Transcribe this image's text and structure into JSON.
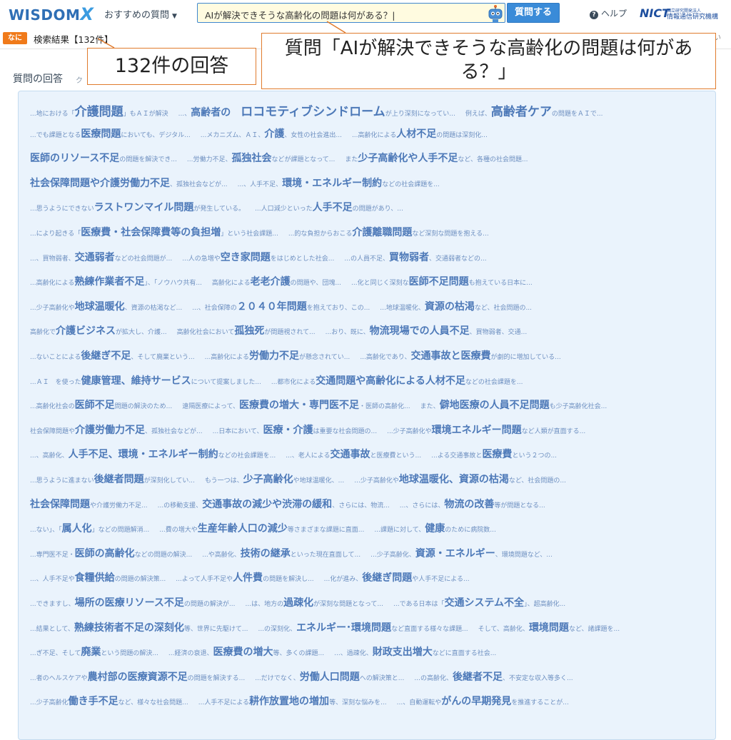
{
  "header": {
    "logo_main": "WISDOM",
    "logo_x": "X",
    "recommended_label": "おすすめの質問",
    "search_value": "AIが解決できそうな高齢化の問題は何がある？|",
    "ask_button": "質問する",
    "help_label": "ヘルプ",
    "nict_mark": "NICT",
    "nict_org_small": "国立研究開発法人",
    "nict_org": "情報通信研究機構"
  },
  "subbar": {
    "tag": "なに",
    "result_count": "検索結果【132件】",
    "right_text": "さい"
  },
  "section": {
    "title": "質問の回答",
    "sub": "ク"
  },
  "callouts": {
    "count": "132件の回答",
    "question": "質問「AIが解決できそうな高齢化の問題は何がある？」"
  },
  "colors": {
    "accent": "#3a8bd8",
    "tag_orange": "#f07a1a",
    "panel_bg": "#eaf3fc",
    "keyword": "#4d79b8",
    "snippet": "#6d8fc0"
  },
  "rows": [
    {
      "items": [
        [
          "...地における「",
          "介護問題",
          "」もＡＩが解決",
          1
        ],
        [
          "...、",
          "高齢者の",
          "",
          0
        ],
        [
          "",
          "ロコモティブシンドローム",
          "が上り深刻になってい...",
          1
        ],
        [
          "例えば、",
          "高齢者ケア",
          "の問題をＡＩで...",
          1
        ]
      ]
    },
    {
      "items": [
        [
          "...でも課題となる",
          "医療問題",
          "においても、デジタル...",
          0
        ],
        [
          "...メカニズム、ＡＩ、",
          "介護",
          "、女性の社会進出...",
          0
        ],
        [
          "...高齢化による",
          "人材不足",
          "の問題は深刻化...",
          0
        ]
      ]
    },
    {
      "items": [
        [
          "",
          "医師のリソース不足",
          "の問題を解決でき...",
          0
        ],
        [
          "...労働力不足、",
          "孤独社会",
          "などが課題となって...",
          0
        ],
        [
          "また",
          "少子高齢化や人手不足",
          "など、各種の社会問題...",
          0
        ]
      ]
    },
    {
      "items": [
        [
          "",
          "社会保障問題や介護労働力不足",
          "、孤独社会などが...",
          0
        ],
        [
          "...、人手不足、",
          "環境・エネルギー制約",
          "などの社会課題を...",
          0
        ]
      ]
    },
    {
      "items": [
        [
          "...思うようにできない",
          "ラストワンマイル問題",
          "が発生している。",
          0
        ],
        [
          "...人口減少といった",
          "人手不足",
          "の問題があり、...",
          0
        ]
      ]
    },
    {
      "items": [
        [
          "...により起きる「",
          "医療費・社会保障費等の負担増",
          "」という社会課題...",
          0
        ],
        [
          "...的な負担からおこる",
          "介護離職問題",
          "など深刻な問題を抱える...",
          0
        ]
      ]
    },
    {
      "items": [
        [
          "...、買物弱者、",
          "交通弱者",
          "などの社会問題が...",
          0
        ],
        [
          "...人の急増や",
          "空き家問題",
          "をはじめとした社会...",
          0
        ],
        [
          "...の人員不足、",
          "買物弱者",
          "、交通弱者などの...",
          0
        ]
      ]
    },
    {
      "items": [
        [
          "...高齢化による",
          "熟練作業者不足",
          "」、「ノウハウ共有...",
          0
        ],
        [
          "高齢化による",
          "老老介護",
          "の問題や、団塊...",
          0
        ],
        [
          "...化と同じく深刻な",
          "医師不足問題",
          "も抱えている日本に...",
          0
        ]
      ]
    },
    {
      "items": [
        [
          "...少子高齢化や",
          "地球温暖化",
          "、資源の枯渇など...",
          0
        ],
        [
          "...、社会保障の",
          "２０４０年問題",
          "を抱えており、この...",
          0
        ],
        [
          "...地球温暖化、",
          "資源の枯渇",
          "など、社会問題の...",
          0
        ]
      ]
    },
    {
      "items": [
        [
          "高齢化で",
          "介護ビジネス",
          "が拡大し、介護...",
          0
        ],
        [
          "高齢化社会において",
          "孤独死",
          "が問題視されて...",
          0
        ],
        [
          "...おり、既に、",
          "物流現場での人員不足",
          "、買物弱者、交通...",
          0
        ]
      ]
    },
    {
      "items": [
        [
          "...ないことによる",
          "後継ぎ不足",
          "、そして廃業という...",
          0
        ],
        [
          "...高齢化による",
          "労働力不足",
          "が懸念されてい...",
          0
        ],
        [
          "...高齢化であり、",
          "交通事故と医療費",
          "が劇的に増加している...",
          0
        ]
      ]
    },
    {
      "items": [
        [
          "...ＡＩ　を使った",
          "健康管理、維持サービス",
          "について提案しました...",
          0
        ],
        [
          "...都市化による",
          "交通問題や高齢化による人材不足",
          "などの社会課題を...",
          0
        ]
      ]
    },
    {
      "items": [
        [
          "...高齢化社会の",
          "医師不足",
          "問題の解決のため...",
          0
        ],
        [
          "遠隔医療によって、",
          "医療費の増大・専門医不足",
          "・医師の高齢化...",
          0
        ],
        [
          "また、",
          "僻地医療の人員不足問題",
          "も少子高齢化社会...",
          0
        ]
      ]
    },
    {
      "items": [
        [
          "社会保障問題や",
          "介護労働力不足",
          "、孤独社会などが...",
          0
        ],
        [
          "...日本において、",
          "医療・介護",
          "は重要な社会問題の...",
          0
        ],
        [
          "...少子高齢化や",
          "環境エネルギー問題",
          "など人類が直面する...",
          0
        ]
      ]
    },
    {
      "items": [
        [
          "...、高齢化、",
          "人手不足、環境・エネルギー制約",
          "などの社会課題を...",
          0
        ],
        [
          "...、老人による",
          "交通事故",
          "と医療費という...",
          0
        ],
        [
          "...よる交通事故と",
          "医療費",
          "という２つの...",
          0
        ]
      ]
    },
    {
      "items": [
        [
          "...思うように進まない",
          "後継者問題",
          "が深刻化してい...",
          0
        ],
        [
          "もう一つは、",
          "少子高齢化",
          "や地球温暖化、...",
          0
        ],
        [
          "...少子高齢化や",
          "地球温暖化、資源の枯渇",
          "など、社会問題の...",
          0
        ]
      ]
    },
    {
      "items": [
        [
          "",
          "社会保障問題",
          "や介護労働力不足...",
          0
        ],
        [
          "...の移動支援、",
          "交通事故の減少や渋滞の緩和",
          "、さらには、物流...",
          0
        ],
        [
          "...、さらには、",
          "物流の改善",
          "等が問題となる...",
          0
        ]
      ]
    },
    {
      "items": [
        [
          "...ない」、「",
          "属人化",
          "」などの問題解消...",
          0
        ],
        [
          "...費の増大や",
          "生産年齢人口の減少",
          "等さまざまな課題に直面...",
          0
        ],
        [
          "...課題に対して、",
          "健康",
          "のために病院数...",
          0
        ]
      ]
    },
    {
      "items": [
        [
          "...専門医不足・",
          "医師の高齢化",
          "などの問題の解決...",
          0
        ],
        [
          "...や高齢化、",
          "技術の継承",
          "といった現在直面して...",
          0
        ],
        [
          "...少子高齢化、",
          "資源・エネルギー",
          "、環境問題など、...",
          0
        ]
      ]
    },
    {
      "items": [
        [
          "...、人手不足や",
          "食糧供給",
          "の問題の解決策...",
          0
        ],
        [
          "...よって人手不足や",
          "人件費",
          "の問題を解決し...",
          0
        ],
        [
          "...化が進み、",
          "後継ぎ問題",
          "や人手不足による...",
          0
        ]
      ]
    },
    {
      "items": [
        [
          "...できますし、",
          "場所の医療リソース不足",
          "の問題の解決が...",
          0
        ],
        [
          "...は、地方の",
          "過疎化",
          "が深刻な問題となって...",
          0
        ],
        [
          "...である日本は「",
          "交通システム不全",
          "」、超高齢化...",
          0
        ]
      ]
    },
    {
      "items": [
        [
          "...結果として、",
          "熟練技術者不足の深刻化",
          "等、世界に先駆けて...",
          0
        ],
        [
          "...の深刻化、",
          "エネルギー･環境問題",
          "など直面する様々な課題...",
          0
        ],
        [
          "そして、高齢化、",
          "環境問題",
          "など、諸課題を...",
          0
        ]
      ]
    },
    {
      "items": [
        [
          "...ぎ不足、そして",
          "廃業",
          "という問題の解決...",
          0
        ],
        [
          "...経済の衰退、",
          "医療費の増大",
          "等、多くの課題...",
          0
        ],
        [
          "...、過疎化、",
          "財政支出増大",
          "などに直面する社会...",
          0
        ]
      ]
    },
    {
      "items": [
        [
          "...者のヘルスケアや",
          "農村部の医療資源不足",
          "の問題を解決する...",
          0
        ],
        [
          "...だけでなく、",
          "労働人口問題",
          "への解決策と...",
          0
        ],
        [
          "...の高齢化、",
          "後継者不足",
          "、不安定な収入等多く...",
          0
        ]
      ]
    },
    {
      "items": [
        [
          "...少子高齢化",
          "働き手不足",
          "など、様々な社会問題...",
          0
        ],
        [
          "...人手不足による",
          "耕作放置地の増加",
          "等、深刻な悩みを...",
          0
        ],
        [
          "...、自動運転や",
          "がんの早期発見",
          "を推進することが...",
          0
        ]
      ]
    }
  ]
}
